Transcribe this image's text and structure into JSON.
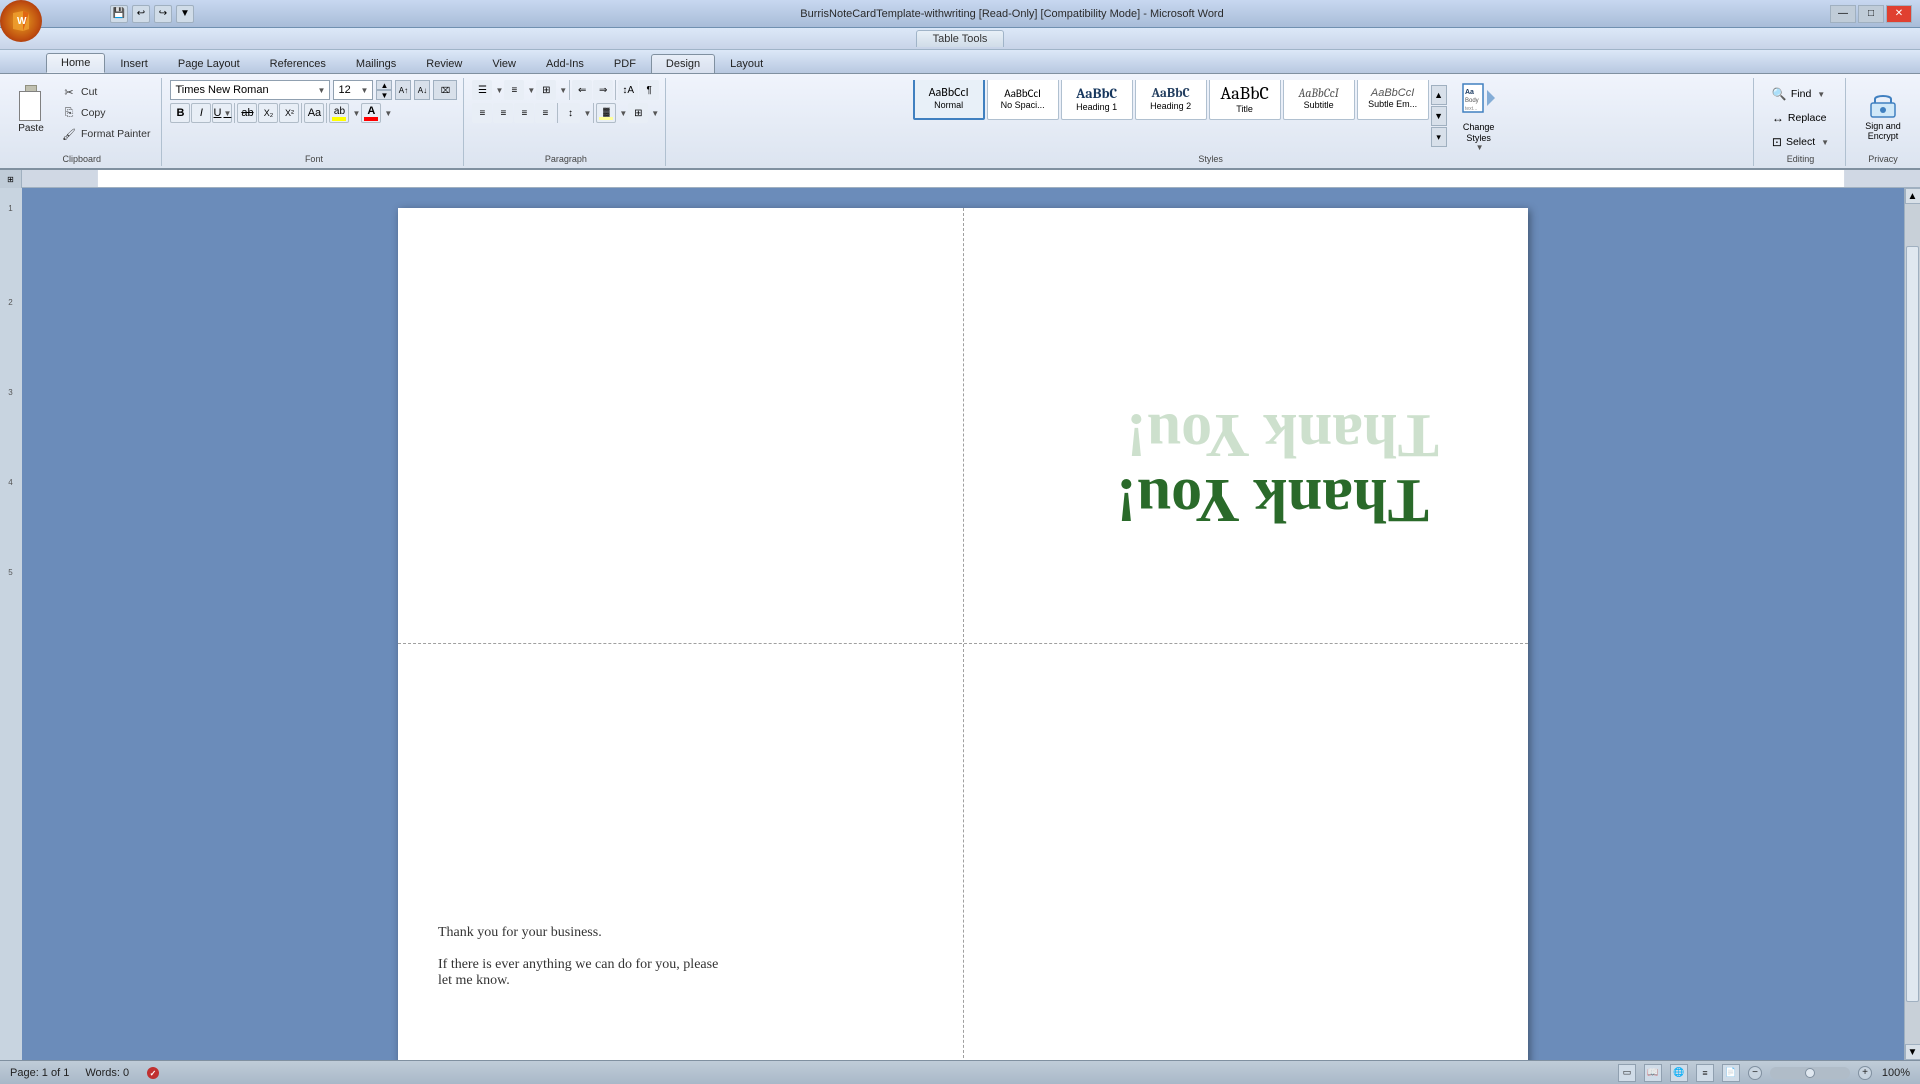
{
  "titlebar": {
    "title": "BurrisNoteCardTemplate-withwriting [Read-Only] [Compatibility Mode] - Microsoft Word",
    "office_btn": "W",
    "quick_save": "💾",
    "quick_undo": "↩",
    "quick_redo": "↪",
    "minimize": "—",
    "maximize": "□",
    "close": "✕"
  },
  "tabletools": {
    "label": "Table Tools"
  },
  "tabs": [
    {
      "label": "Home",
      "active": true
    },
    {
      "label": "Insert",
      "active": false
    },
    {
      "label": "Page Layout",
      "active": false
    },
    {
      "label": "References",
      "active": false
    },
    {
      "label": "Mailings",
      "active": false
    },
    {
      "label": "Review",
      "active": false
    },
    {
      "label": "View",
      "active": false
    },
    {
      "label": "Add-Ins",
      "active": false
    },
    {
      "label": "PDF",
      "active": false
    },
    {
      "label": "Design",
      "active": true,
      "table_tab": true
    },
    {
      "label": "Layout",
      "active": false,
      "table_tab": true
    }
  ],
  "clipboard": {
    "label": "Clipboard",
    "paste_label": "Paste",
    "cut_label": "Cut",
    "copy_label": "Copy",
    "format_painter_label": "Format Painter"
  },
  "font": {
    "label": "Font",
    "font_name": "Times New Roman",
    "font_size": "12",
    "bold": "B",
    "italic": "I",
    "underline": "U",
    "strikethrough": "ab",
    "subscript": "x₂",
    "superscript": "x²",
    "change_case": "Aa",
    "highlight": "ab",
    "font_color": "A"
  },
  "paragraph": {
    "label": "Paragraph"
  },
  "styles": {
    "label": "Styles",
    "items": [
      {
        "name": "Normal",
        "preview": "AaBbCcI",
        "active": true
      },
      {
        "name": "No Spaci...",
        "preview": "AaBbCcI"
      },
      {
        "name": "Heading 1",
        "preview": "AaBbC"
      },
      {
        "name": "Heading 2",
        "preview": "AaBbC"
      },
      {
        "name": "Title",
        "preview": "AaBbC"
      },
      {
        "name": "Subtitle",
        "preview": "AaBbCcI"
      },
      {
        "name": "Subtle Em...",
        "preview": "AaBbCcI"
      }
    ],
    "change_styles_label": "Change\nStyles"
  },
  "editing": {
    "label": "Editing",
    "find_label": "Find",
    "replace_label": "Replace",
    "select_label": "Select"
  },
  "document": {
    "thank_you_line1": "Thank You!",
    "thank_you_line2": "Thank You!",
    "message_line1": "Thank you for your business.",
    "message_line2": "If there is ever anything we can do for you, please",
    "message_line3": "let me know."
  },
  "statusbar": {
    "page_info": "Page: 1 of 1",
    "words": "Words: 0",
    "zoom": "100%"
  }
}
